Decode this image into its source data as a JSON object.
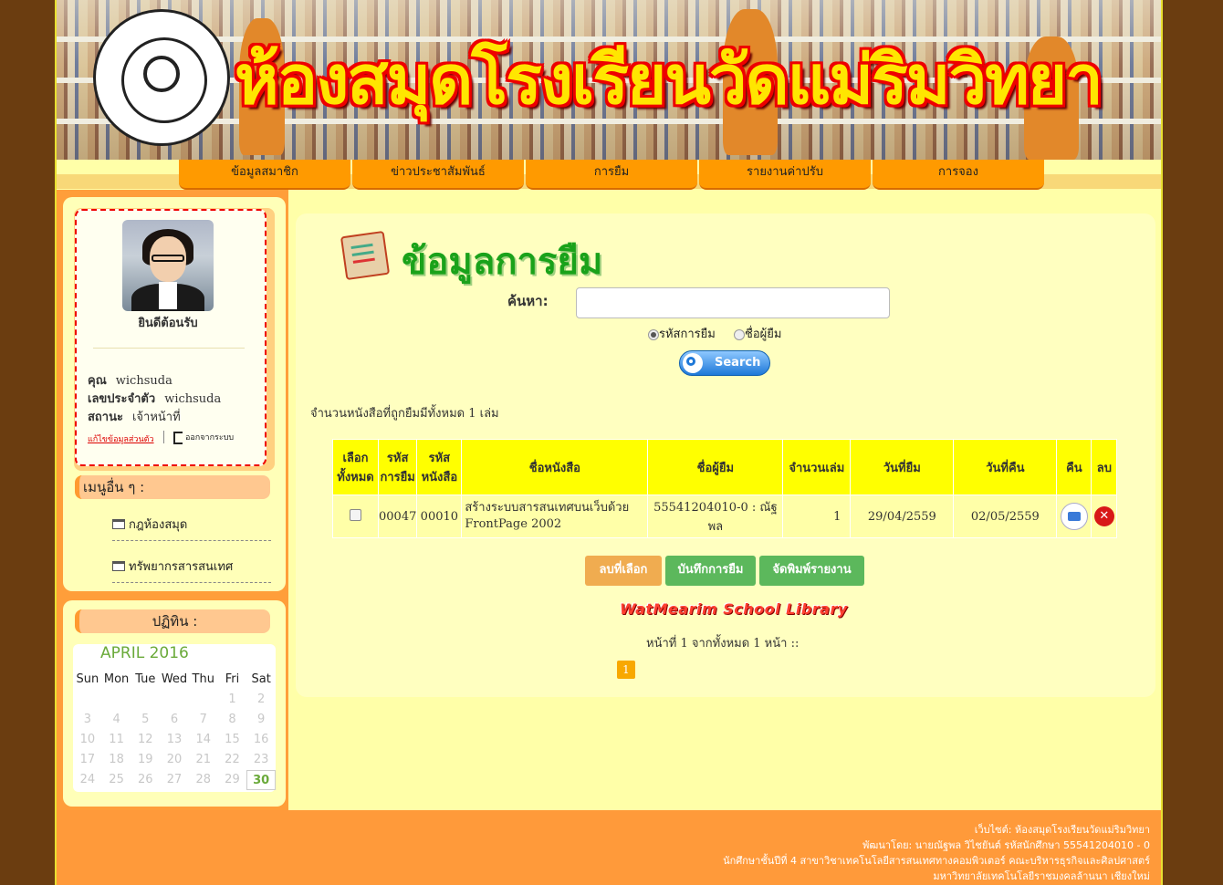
{
  "header": {
    "site_title": "ห้องสมุดโรงเรียนวัดแม่ริมวิทยา"
  },
  "nav": [
    "ข้อมูลสมาชิก",
    "ข่าวประชาสัมพันธ์",
    "การยืม",
    "รายงานค่าปรับ",
    "การจอง"
  ],
  "profile": {
    "welcome": "ยินดีต้อนรับ",
    "name_label": "คุณ",
    "name_value": "wichsuda",
    "id_label": "เลขประจำตัว",
    "id_value": "wichsuda",
    "status_label": "สถานะ",
    "status_value": "เจ้าหน้าที่",
    "edit_link": "แก้ไขข้อมูลส่วนตัว",
    "logout": "ออกจากระบบ"
  },
  "other_menu": {
    "title": "เมนูอื่น ๆ :",
    "items": [
      "กฎห้องสมุด",
      "ทรัพยากรสารสนเทศ"
    ]
  },
  "calendar": {
    "title": "ปฏิทิน :",
    "month": "APRIL 2016",
    "days": [
      "Sun",
      "Mon",
      "Tue",
      "Wed",
      "Thu",
      "Fri",
      "Sat"
    ],
    "weeks": [
      [
        "",
        "",
        "",
        "",
        "",
        "1",
        "2"
      ],
      [
        "3",
        "4",
        "5",
        "6",
        "7",
        "8",
        "9"
      ],
      [
        "10",
        "11",
        "12",
        "13",
        "14",
        "15",
        "16"
      ],
      [
        "17",
        "18",
        "19",
        "20",
        "21",
        "22",
        "23"
      ],
      [
        "24",
        "25",
        "26",
        "27",
        "28",
        "29",
        "30"
      ]
    ],
    "today": "30"
  },
  "main": {
    "title": "ข้อมูลการยืม",
    "search_label": "ค้นหา:",
    "search_value": "",
    "radio_options": [
      "รหัสการยืม",
      "ชื่อผู้ยืม"
    ],
    "radio_selected": "รหัสการยืม",
    "search_button": "Search",
    "count_text": "จำนวนหนังสือที่ถูกยืมมีทั้งหมด 1 เล่ม",
    "table": {
      "headers": [
        "เลือกทั้งหมด",
        "รหัสการยืม",
        "รหัสหนังสือ",
        "ชื่อหนังสือ",
        "ชื่อผู้ยืม",
        "จำนวนเล่ม",
        "วันที่ยืม",
        "วันที่คืน",
        "คืน",
        "ลบ"
      ],
      "rows": [
        {
          "borrow_id": "00047",
          "book_id": "00010",
          "title": "สร้างระบบสารสนเทศบนเว็บด้วย FrontPage 2002",
          "borrower": "55541204010-0 : ณัฐพล",
          "qty": "1",
          "borrow_date": "29/04/2559",
          "return_date": "02/05/2559"
        }
      ]
    },
    "buttons": {
      "delete": "ลบที่เลือก",
      "save": "บันทึกการยืม",
      "print": "จัดพิมพ์รายงาน"
    },
    "brand": "WatMearim School Library",
    "pager_text": "หน้าที่ 1 จากทั้งหมด 1 หน้า ::",
    "page": "1"
  },
  "footer": {
    "line1": "เว็บไซต์: ห้องสมุดโรงเรียนวัดแม่ริมวิทยา",
    "line2": "พัฒนาโดย: นายณัฐพล วิไชยันต์ รหัสนักศึกษา 55541204010 - 0",
    "line3": "นักศึกษาชั้นปีที่ 4 สาขาวิชาเทคโนโลยีสารสนเทศทางคอมพิวเตอร์ คณะบริหารธุรกิจและศิลปศาสตร์",
    "line4": "มหาวิทยาลัยเทคโนโลยีราชมงคลล้านนา เชียงใหม่"
  },
  "colors": {
    "nav": "#ff9a00",
    "page_bg": "#ffffa8",
    "title_green": "#1aa21a",
    "table_header": "#ffff00",
    "footer": "#ff9a3a"
  }
}
